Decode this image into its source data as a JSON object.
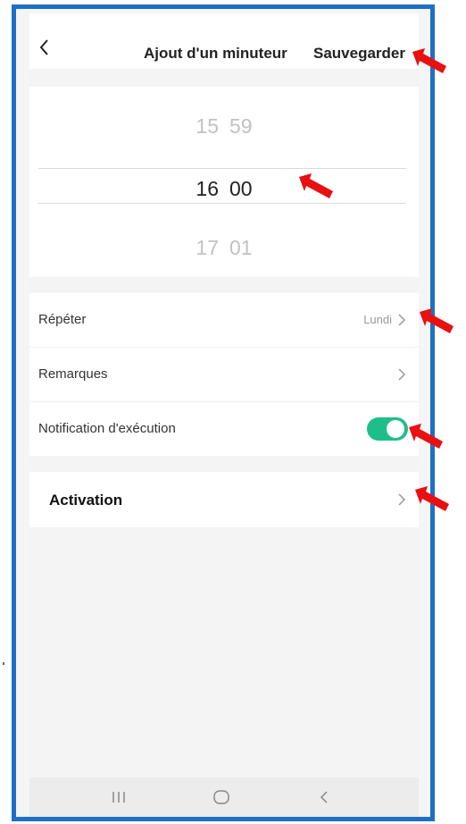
{
  "header": {
    "title": "Ajout d'un minuteur",
    "save_label": "Sauvegarder"
  },
  "time_picker": {
    "previous": {
      "hour": "15",
      "minute": "59"
    },
    "selected": {
      "hour": "16",
      "minute": "00"
    },
    "next": {
      "hour": "17",
      "minute": "01"
    }
  },
  "settings": {
    "repeat": {
      "label": "Répéter",
      "value": "Lundi"
    },
    "remarks": {
      "label": "Remarques"
    },
    "notification": {
      "label": "Notification d'exécution",
      "enabled": true
    }
  },
  "activation": {
    "label": "Activation"
  },
  "colors": {
    "frame_border": "#1f6fc5",
    "toggle_on": "#1ebe8a",
    "annotation_arrow": "#e81010"
  },
  "icons": {
    "back": "chevron-left-icon",
    "chevron": "chevron-right-icon",
    "nav_recents": "recents-icon",
    "nav_home": "home-icon",
    "nav_back": "back-icon",
    "annotation": "red-arrow-icon"
  }
}
